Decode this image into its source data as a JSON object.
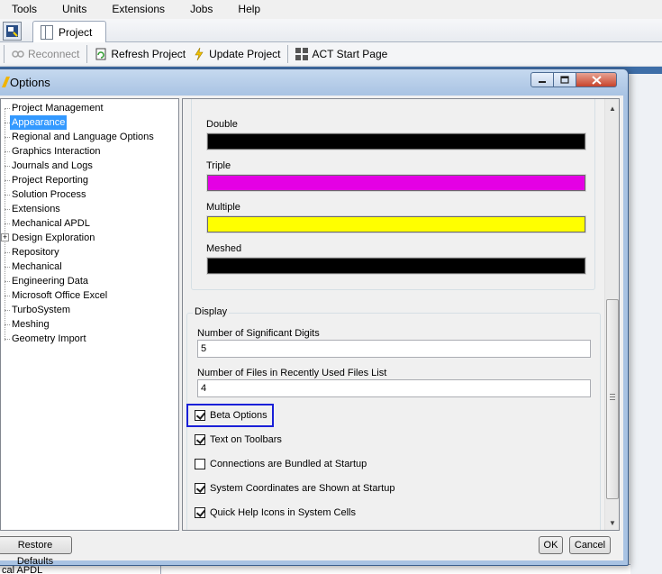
{
  "menubar": {
    "items": [
      "Tools",
      "Units",
      "Extensions",
      "Jobs",
      "Help"
    ]
  },
  "tabs": {
    "project": "Project"
  },
  "toolbar": {
    "reconnect": "Reconnect",
    "refresh": "Refresh Project",
    "update": "Update Project",
    "act": "ACT Start Page"
  },
  "dialog": {
    "title": "Options",
    "tree": [
      "Project Management",
      "Appearance",
      "Regional and Language Options",
      "Graphics Interaction",
      "Journals and Logs",
      "Project Reporting",
      "Solution Process",
      "Extensions",
      "Mechanical APDL",
      "Design Exploration",
      "Repository",
      "Mechanical",
      "Engineering Data",
      "Microsoft Office Excel",
      "TurboSystem",
      "Meshing",
      "Geometry Import"
    ],
    "selected_tree_item": "Appearance",
    "colors": [
      {
        "label": "Double",
        "color": "#000000"
      },
      {
        "label": "Triple",
        "color": "#e400e4"
      },
      {
        "label": "Multiple",
        "color": "#ffff00"
      },
      {
        "label": "Meshed",
        "color": "#000000"
      }
    ],
    "display": {
      "title": "Display",
      "sig_digits_label": "Number of Significant Digits",
      "sig_digits_value": "5",
      "recent_files_label": "Number of Files in Recently Used Files List",
      "recent_files_value": "4",
      "checkboxes": [
        {
          "label": "Beta Options",
          "checked": true
        },
        {
          "label": "Text on Toolbars",
          "checked": true
        },
        {
          "label": "Connections are Bundled at Startup",
          "checked": false
        },
        {
          "label": "System Coordinates are Shown at Startup",
          "checked": true
        },
        {
          "label": "Quick Help Icons in System Cells",
          "checked": true
        }
      ]
    },
    "buttons": {
      "restore": "Restore Defaults",
      "ok": "OK",
      "cancel": "Cancel"
    }
  },
  "background": {
    "bottom_text": "cal APDL"
  }
}
